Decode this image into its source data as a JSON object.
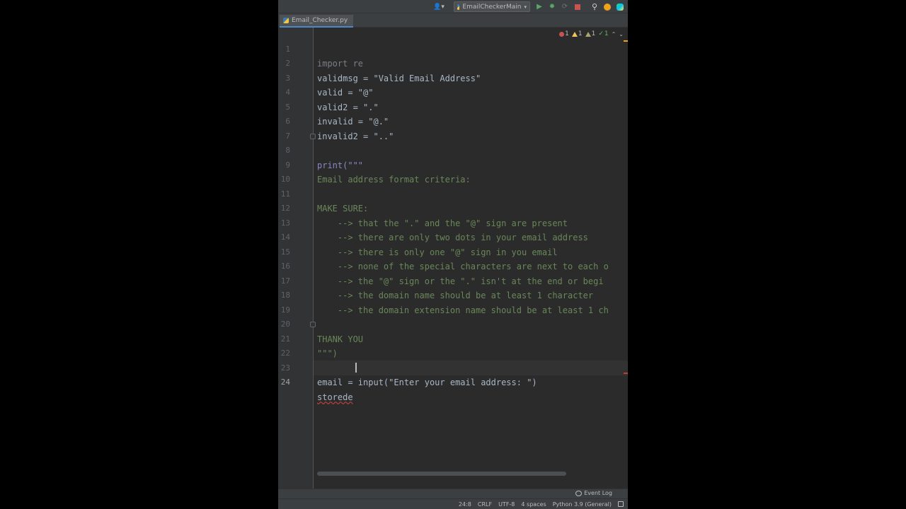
{
  "toolbar": {
    "run_config": "EmailCheckerMain",
    "user_glyph": "👤",
    "user_chevron": "▾",
    "run_glyph": "▶",
    "debug_glyph": "✹",
    "coverage_glyph": "⟳",
    "search_glyph": "⚲",
    "config_chevron": "▾"
  },
  "tabs": [
    {
      "label": "Email_Checker.py",
      "active": true
    }
  ],
  "inspections": {
    "errors": "1",
    "warnings": "1",
    "weak_warnings": "1",
    "typos": "1",
    "ok_glyph": "✓",
    "prev_glyph": "⌃",
    "next_glyph": "⌄"
  },
  "editor": {
    "lines": [
      {
        "n": "1",
        "text": "import re"
      },
      {
        "n": "2",
        "text": "validmsg = \"Valid Email Address\""
      },
      {
        "n": "3",
        "text": "valid = \"@\""
      },
      {
        "n": "4",
        "text": "valid2 = \".\""
      },
      {
        "n": "5",
        "text": "invalid = \"@.\""
      },
      {
        "n": "6",
        "text": "invalid2 = \"..\""
      },
      {
        "n": "7",
        "text": ""
      },
      {
        "n": "8",
        "text": "print(\"\"\""
      },
      {
        "n": "9",
        "text": "Email address format criteria:"
      },
      {
        "n": "10",
        "text": ""
      },
      {
        "n": "11",
        "text": "MAKE SURE:"
      },
      {
        "n": "12",
        "text": "    --> that the \".\" and the \"@\" sign are present"
      },
      {
        "n": "13",
        "text": "    --> there are only two dots in your email address"
      },
      {
        "n": "14",
        "text": "    --> there is only one \"@\" sign in you email"
      },
      {
        "n": "15",
        "text": "    --> none of the special characters are next to each o"
      },
      {
        "n": "16",
        "text": "    --> the \"@\" sign or the \".\" isn't at the end or begi"
      },
      {
        "n": "17",
        "text": "    --> the domain name should be at least 1 character"
      },
      {
        "n": "18",
        "text": "    --> the domain extension name should be at least 1 ch"
      },
      {
        "n": "19",
        "text": ""
      },
      {
        "n": "20",
        "text": "THANK YOU"
      },
      {
        "n": "21",
        "text": "\"\"\")"
      },
      {
        "n": "22",
        "text": ""
      },
      {
        "n": "23",
        "text": "email = input(\"Enter your email address: \")"
      },
      {
        "n": "24",
        "text": "storede"
      }
    ]
  },
  "bottom": {
    "event_log": "Event Log"
  },
  "status": {
    "position": "24:8",
    "line_separator": "CRLF",
    "encoding": "UTF-8",
    "indent": "4 spaces",
    "interpreter": "Python 3.9 (General)"
  },
  "colors": {
    "background": "#2b2b2b",
    "gutter": "#313335",
    "string": "#6a8759",
    "keyword": "#cc7832",
    "builtin": "#8888c6",
    "identifier": "#a9b7c6",
    "error": "#bc3f3c"
  }
}
